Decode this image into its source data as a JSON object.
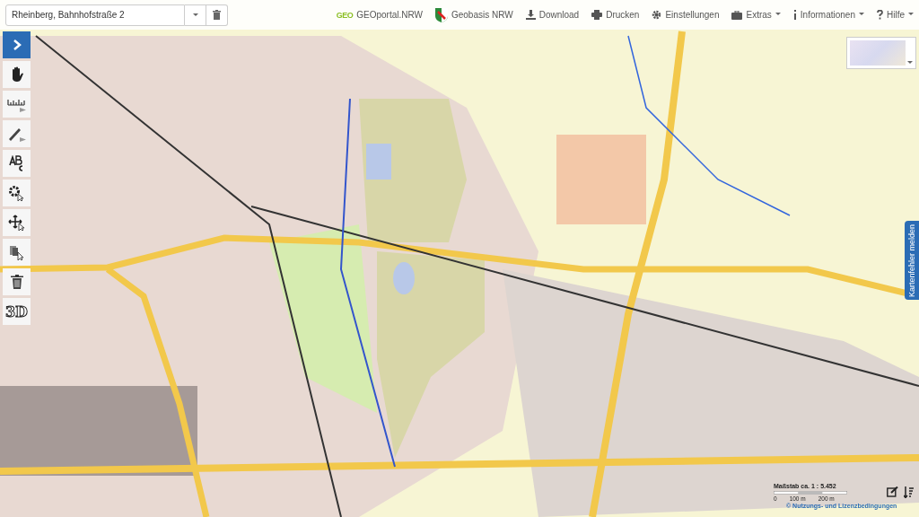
{
  "search": {
    "value": "Rheinberg, Bahnhofstraße 2"
  },
  "nav": [
    {
      "kind": "brand",
      "label": "GEOportal.NRW",
      "logo": "GEO"
    },
    {
      "kind": "crest",
      "label": "Geobasis NRW"
    },
    {
      "kind": "download",
      "label": "Download"
    },
    {
      "kind": "print",
      "label": "Drucken"
    },
    {
      "kind": "gear",
      "label": "Einstellungen"
    },
    {
      "kind": "case",
      "label": "Extras",
      "menu": true
    },
    {
      "kind": "info",
      "label": "Informationen",
      "menu": true
    },
    {
      "kind": "help",
      "label": "Hilfe",
      "menu": true
    }
  ],
  "tools": [
    {
      "kind": "expand",
      "selected": true
    },
    {
      "kind": "pan",
      "selected": false
    },
    {
      "kind": "measure",
      "selected": false
    },
    {
      "kind": "draw",
      "selected": false
    },
    {
      "kind": "text",
      "selected": false
    },
    {
      "kind": "settings",
      "selected": false
    },
    {
      "kind": "move",
      "selected": false
    },
    {
      "kind": "select",
      "selected": false
    },
    {
      "kind": "delete",
      "selected": false
    },
    {
      "kind": "threed",
      "label": "3D",
      "selected": false
    }
  ],
  "side_tab": {
    "label": "Kartenfehler melden"
  },
  "scale": {
    "label": "Maßstab ca. 1 : 5.452",
    "ticks": [
      "0",
      "100 m",
      "200 m"
    ]
  },
  "license_link": "© Nutzungs- und Lizenzbedingungen"
}
